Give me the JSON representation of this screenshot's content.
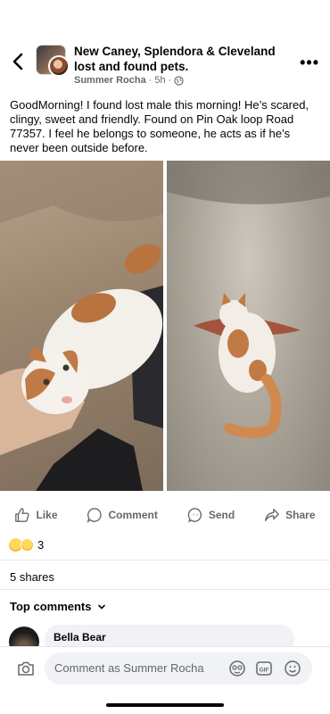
{
  "header": {
    "group_name": "New Caney, Splendora & Cleveland lost and found pets.",
    "author": "Summer Rocha",
    "time": "5h",
    "separator": "·"
  },
  "post": {
    "text": "GoodMorning! I found lost male this morning! He’s scared, clingy, sweet and friendly. Found on Pin Oak loop Road 77357.  I feel he belongs to someone, he acts as if he’s never been outside before."
  },
  "actions": {
    "like": "Like",
    "comment": "Comment",
    "send": "Send",
    "share": "Share"
  },
  "stats": {
    "reaction_count": "3",
    "shares": "5 shares"
  },
  "comments": {
    "section_label": "Top comments",
    "first_author": "Bella Bear"
  },
  "composer": {
    "placeholder": "Comment as Summer Rocha"
  },
  "colors": {
    "secondary_text": "#65676b",
    "bubble": "#f0f2f5",
    "divider": "#e4e6eb"
  }
}
